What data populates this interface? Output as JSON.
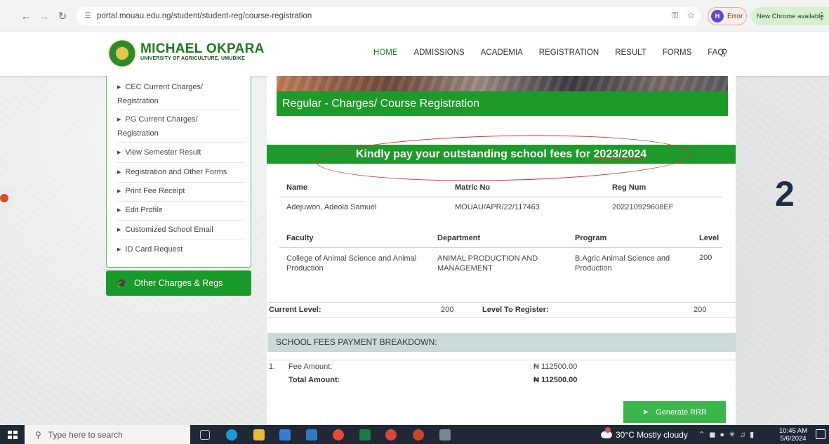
{
  "browser": {
    "url": "portal.mouau.edu.ng/student/student-reg/course-registration",
    "error_label": "Error",
    "profile_initial": "H",
    "update_label": "New Chrome available"
  },
  "site": {
    "logo_title": "MICHAEL OKPARA",
    "logo_subtitle": "UNIVERSITY OF AGRICULTURE, UMUDIKE",
    "nav": [
      "HOME",
      "ADMISSIONS",
      "ACADEMIA",
      "REGISTRATION",
      "RESULT",
      "FORMS",
      "FAQ"
    ],
    "active_nav": "HOME"
  },
  "sidebar": {
    "items": [
      {
        "line1": "CEC Current Charges/",
        "line2": "Registration"
      },
      {
        "line1": "PG Current Charges/",
        "line2": "Registration"
      },
      {
        "line1": "View Semester Result"
      },
      {
        "line1": "Registration and Other Forms"
      },
      {
        "line1": "Print Fee Receipt"
      },
      {
        "line1": "Edit Profile"
      },
      {
        "line1": "Customized School Email"
      },
      {
        "line1": "ID Card Request"
      }
    ],
    "other_button": "Other Charges & Regs"
  },
  "main": {
    "banner": "Regular - Charges/ Course Registration",
    "notice_prefix": "Kindly pay your outstanding school fees for ",
    "notice_year": "2023/2024",
    "student_headers": {
      "name": "Name",
      "matric": "Matric No",
      "reg": "Reg Num"
    },
    "student": {
      "name": "Adejuwon, Adeola Samuel",
      "matric": "MOUAU/APR/22/117463",
      "reg": "202210929608EF"
    },
    "program_headers": {
      "faculty": "Faculty",
      "department": "Department",
      "program": "Program",
      "level": "Level"
    },
    "program": {
      "faculty_l1": "College of Animal Science and Animal",
      "faculty_l2": "Production",
      "department_l1": "ANIMAL PRODUCTION AND",
      "department_l2": "MANAGEMENT",
      "program_l1": "B.Agric Animal Science and",
      "program_l2": "Production",
      "level": "200"
    },
    "current_level_label": "Current Level:",
    "current_level": "200",
    "level_to_register_label": "Level To Register:",
    "level_to_register": "200",
    "payment_header": "SCHOOL FEES PAYMENT BREAKDOWN:",
    "fee_index": "1.",
    "fee_label": "Fee Amount:",
    "fee_amount": "₦ 112500.00",
    "total_label": "Total Amount:",
    "total_amount": "₦ 112500.00",
    "generate_button": "Generate RRR"
  },
  "annotation": {
    "number": "2"
  },
  "taskbar": {
    "search_placeholder": "Type here to search",
    "weather": "30°C  Mostly cloudy",
    "time": "10:45 AM",
    "date": "5/6/2024"
  },
  "colors": {
    "brand_green": "#1e9a2a",
    "annotation_red": "#d8302a",
    "taskbar": "#202836"
  }
}
